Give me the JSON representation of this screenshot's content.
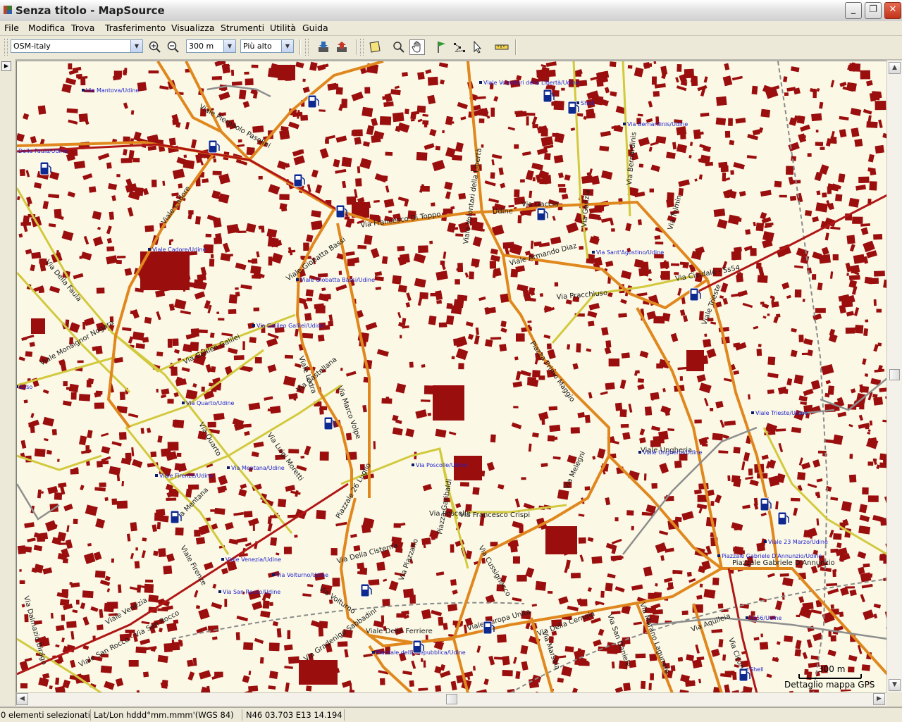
{
  "window": {
    "title": "Senza titolo - MapSource",
    "controls": {
      "minimize": "_",
      "maximize": "❐",
      "close": "✕"
    }
  },
  "menu": [
    "File",
    "Modifica",
    "Trova",
    "Trasferimento",
    "Visualizza",
    "Strumenti",
    "Utilità",
    "Guida"
  ],
  "toolbar": {
    "map_product": "OSM-italy",
    "zoom_level": "300 m",
    "detail_level": "Più alto",
    "icons": [
      "zoom-in-icon",
      "zoom-out-icon",
      "receive-from-device-icon",
      "send-to-device-icon",
      "map-tool-icon",
      "zoom-tool-icon",
      "hand-tool-icon",
      "waypoint-flag-icon",
      "route-tool-icon",
      "selection-tool-icon",
      "distance-tool-icon"
    ],
    "active_tool": "hand-tool-icon"
  },
  "map": {
    "background": "#fbf9e6",
    "building_color": "#9b0e0e",
    "major_road_color": "#e0871e",
    "minor_road_color": "#d2c93e",
    "rail_color": "#7a7a7a",
    "road_labels": [
      "Viale Pierpaolo Pasolini",
      "Via Francesco Di Toppo",
      "Viale Volontari della Libertà",
      "Udine",
      "Via Gaccia",
      "Via Gorizia",
      "Via Bernardinis",
      "Via Tolmin",
      "Viale Armando Diaz",
      "Via Cividale - Ss54",
      "Via Pracchiuso",
      "Viale Trieste",
      "Piazza Primo Maggio",
      "Viale Cadore",
      "Via Della Faula",
      "Viale Giobatta Bassi",
      "Viale Monsignor Nogara",
      "Via Galileo Galilei",
      "Via Castellana",
      "Via Marco Volpe",
      "Viale Ledra",
      "Via Luigi Moretti",
      "Via Quarto",
      "Piazzale 26 Luglio",
      "Via Mentana",
      "Viale Firenze",
      "Viale Venezia",
      "Viale San Rocco - Via San Rocco",
      "Via Dalmazio Birago",
      "Via Gradenigo Sabbadini",
      "Via Volturno",
      "Via Della Cisterna",
      "Viale Ungheria",
      "Via Piazzano",
      "Piazza Garibaldi",
      "Via Francesco Crispi",
      "Via Cussignacco",
      "Viale Delle Ferriere",
      "Viale Europa Unita",
      "Via Della Cernaia",
      "Via Marsala",
      "Via San Daniele",
      "Via Marano Lagunare",
      "Via Aquileia",
      "Piazzale Gabriele D'Annunzio",
      "Via Melegni",
      "Via Ciconi",
      "Via Poscolle"
    ],
    "poi_labels": [
      "Via Mantova/Udine",
      "Della Faula/Udine",
      "Viale Cadore/Udine",
      "Viale Volontari della Libertà/Udine",
      "Shell",
      "Via Bernardinis/Udine",
      "Via Sant'Agostino/Udine",
      "Viale Giobatta Bassi/Udine",
      "Via Galileo Galilei/Udine",
      "Esso",
      "Via Quarto/Udine",
      "Viale Firenze/Udine",
      "Via Mentana/Udine",
      "Via Poscolle/Udine",
      "Viale Trieste/Udine",
      "Viale Ungheria/Udine",
      "Viale 23 Marzo/Udine",
      "Piazzale Gabriele D'Annunzio/Udine",
      "Viale Venezia/Udine",
      "Via Volturno/Udine",
      "Via San Rocco/Udine",
      "Piazzale della Repubblica/Udine",
      "Ss56/Udine",
      "Shell"
    ],
    "scale_label": "300 m",
    "detail_caption": "Dettaglio mappa GPS"
  },
  "statusbar": {
    "selection": "0 elementi selezionati",
    "coord_format": "Lat/Lon hddd°mm.mmm'(WGS 84)",
    "cursor_position": "N46 03.703 E13 14.194"
  }
}
